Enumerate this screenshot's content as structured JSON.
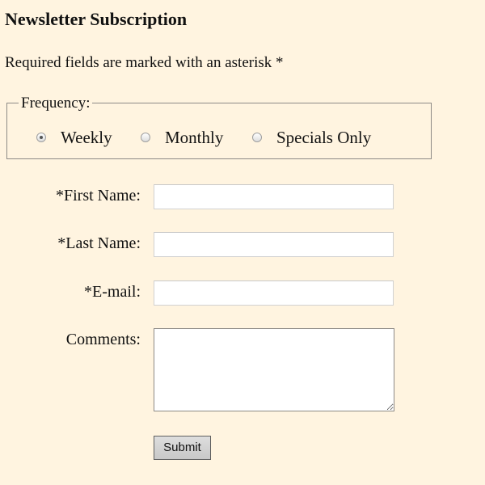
{
  "page": {
    "title": "Newsletter Subscription",
    "required_note": "Required fields are marked with an asterisk *"
  },
  "frequency": {
    "legend": "Frequency:",
    "options": [
      {
        "label": "Weekly",
        "selected": true
      },
      {
        "label": "Monthly",
        "selected": false
      },
      {
        "label": "Specials Only",
        "selected": false
      }
    ]
  },
  "fields": {
    "first_name": {
      "label": "*First Name:",
      "value": ""
    },
    "last_name": {
      "label": "*Last Name:",
      "value": ""
    },
    "email": {
      "label": "*E-mail:",
      "value": ""
    },
    "comments": {
      "label": "Comments:",
      "value": ""
    }
  },
  "actions": {
    "submit_label": "Submit"
  },
  "colors": {
    "page_background": "#fff4e0",
    "border": "#8d8a86",
    "button_fill": "#d0d0d0"
  }
}
